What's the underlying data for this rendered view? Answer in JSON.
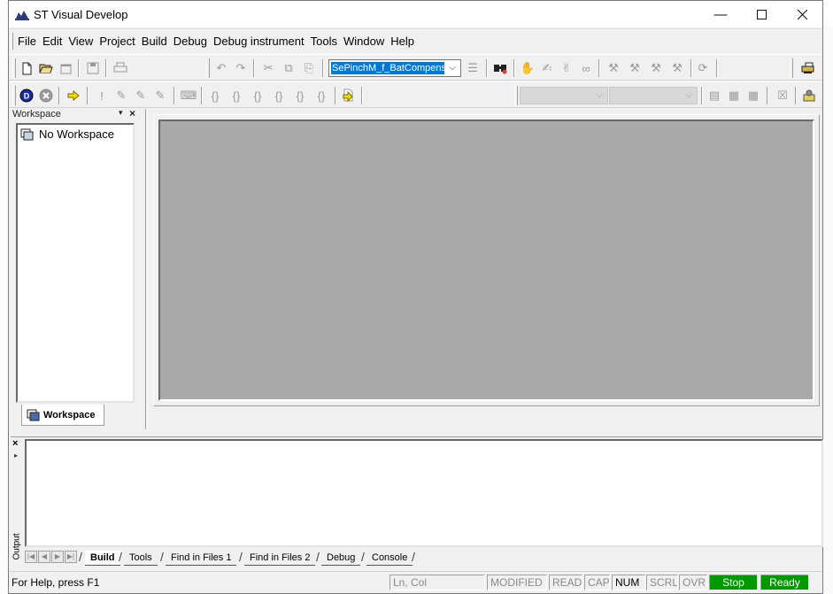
{
  "window": {
    "title": "ST Visual Develop"
  },
  "menu": [
    "File",
    "Edit",
    "View",
    "Project",
    "Build",
    "Debug",
    "Debug instrument",
    "Tools",
    "Window",
    "Help"
  ],
  "toolbar": {
    "symbol_combo_value": "SePinchM_f_BatCompens",
    "combo_arrow": "⌵"
  },
  "workspace": {
    "title": "Workspace",
    "empty_item": "No Workspace",
    "tab_label": "Workspace"
  },
  "output": {
    "side_label": "Output",
    "tabs": [
      "Build",
      "Tools",
      "Find in Files 1",
      "Find in Files 2",
      "Debug",
      "Console"
    ]
  },
  "statusbar": {
    "help_text": "For Help, press F1",
    "position": "Ln, Col",
    "modified": "MODIFIED",
    "read": "READ",
    "cap": "CAP",
    "num": "NUM",
    "scrl": "SCRL",
    "ovr": "OVR",
    "stop": "Stop",
    "ready": "Ready"
  },
  "colors": {
    "status_green": "#009a00",
    "mdi_background": "#a9a9a9",
    "selection": "#0078d7"
  }
}
